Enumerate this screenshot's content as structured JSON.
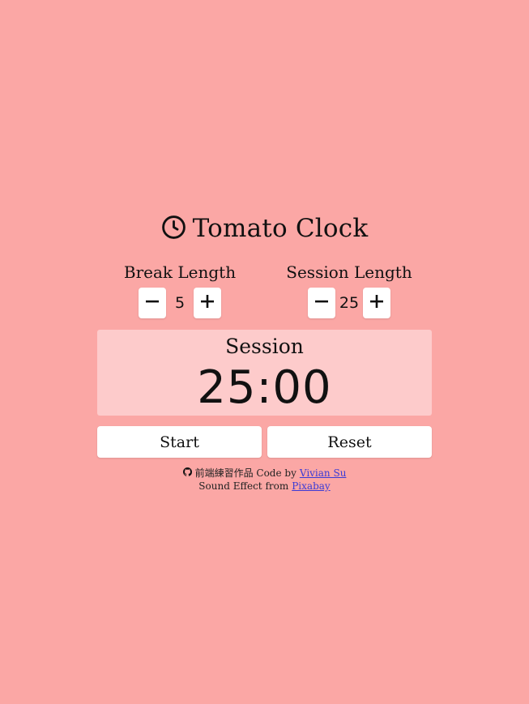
{
  "app": {
    "title": "Tomato Clock",
    "title_icon": "clock-icon"
  },
  "break": {
    "label": "Break Length",
    "value": "5",
    "decrement_icon": "minus-icon",
    "increment_icon": "plus-icon"
  },
  "session": {
    "label": "Session Length",
    "value": "25",
    "decrement_icon": "minus-icon",
    "increment_icon": "plus-icon"
  },
  "timer": {
    "label": "Session",
    "display": "25:00"
  },
  "actions": {
    "start_label": "Start",
    "reset_label": "Reset"
  },
  "footer": {
    "github_icon": "github-icon",
    "line1_prefix": "前端練習作品 Code by",
    "author_link": "Vivian Su",
    "line2_prefix": "Sound Effect from",
    "sound_link": "Pixabay"
  },
  "colors": {
    "background": "#fba7a5",
    "timer_box": "#fdcbcb",
    "link": "#3a3ad6"
  }
}
